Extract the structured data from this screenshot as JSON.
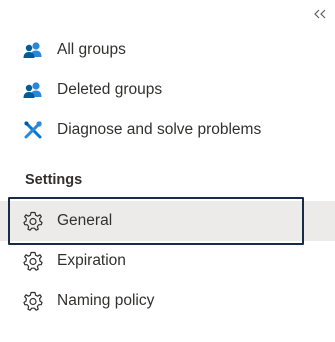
{
  "header": {
    "collapse_icon": "double-chevron-left-icon"
  },
  "nav": {
    "items": [
      {
        "label": "All groups",
        "icon": "groups-icon"
      },
      {
        "label": "Deleted groups",
        "icon": "groups-icon"
      },
      {
        "label": "Diagnose and solve problems",
        "icon": "wrench-screwdriver-icon"
      }
    ]
  },
  "settings": {
    "header": "Settings",
    "items": [
      {
        "label": "General",
        "icon": "gear-icon",
        "selected": true
      },
      {
        "label": "Expiration",
        "icon": "gear-icon"
      },
      {
        "label": "Naming policy",
        "icon": "gear-icon"
      }
    ]
  },
  "colors": {
    "groups_icon_blue": "#2b88d8",
    "wrench_blue": "#0078d4",
    "selected_bg": "#edebe9",
    "focus_border": "#1b2a47",
    "text": "#323130"
  }
}
